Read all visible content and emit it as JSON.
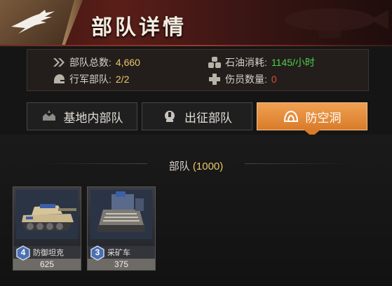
{
  "header": {
    "title": "部队详情",
    "logo_icon": "eagle-icon"
  },
  "stats": {
    "total_troops": {
      "label": "部队总数:",
      "value": "4,660",
      "icon": "troops-icon"
    },
    "oil_consumption": {
      "label": "石油消耗:",
      "value": "1145/小时",
      "icon": "oil-barrels-icon"
    },
    "marching_troops": {
      "label": "行军部队:",
      "value": "2/2",
      "icon": "helmet-icon"
    },
    "wounded": {
      "label": "伤员数量:",
      "value": "0",
      "icon": "medical-cross-icon"
    }
  },
  "tabs": [
    {
      "label": "基地内部队",
      "icon": "base-icon",
      "active": false
    },
    {
      "label": "出征部队",
      "icon": "march-icon",
      "active": false
    },
    {
      "label": "防空洞",
      "icon": "bunker-icon",
      "active": true
    }
  ],
  "section": {
    "label": "部队",
    "count": "(1000)"
  },
  "units": [
    {
      "name": "防御坦克",
      "count": "625",
      "level": "4",
      "icon": "tank-icon"
    },
    {
      "name": "采矿车",
      "count": "375",
      "level": "3",
      "icon": "mining-vehicle-icon"
    }
  ],
  "colors": {
    "accent": "#e08a36",
    "value_yellow": "#e8c56a",
    "value_green": "#4ed04a",
    "value_red": "#e04a3a"
  }
}
